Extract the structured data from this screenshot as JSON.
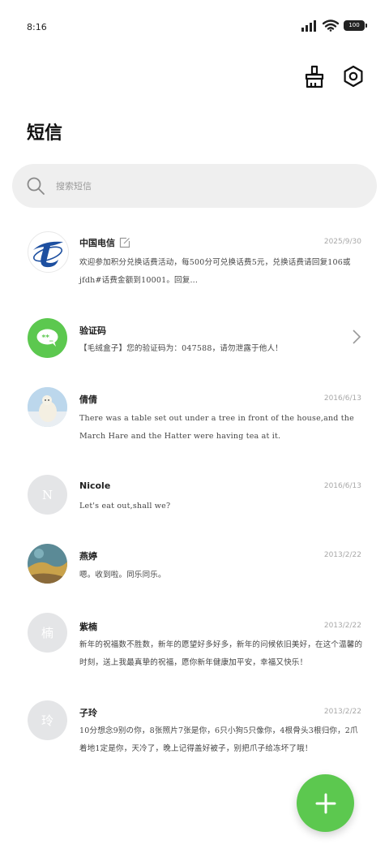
{
  "status_bar": {
    "time": "8:16",
    "battery": "100"
  },
  "header": {
    "title": "短信"
  },
  "search": {
    "placeholder": "搜索短信"
  },
  "conversations": [
    {
      "name": "中国电信",
      "date": "2025/9/30",
      "preview": "欢迎参加积分兑换话费活动，每500分可兑换话费5元，兑换话费请回复106或jfdh#话费金额到10001。回复...",
      "avatar": "china-telecom-logo",
      "has_edit_icon": true
    },
    {
      "name": "验证码",
      "date": "",
      "preview": "【毛绒盒子】您的验证码为：047588，请勿泄露于他人！",
      "avatar": "sms-bubble-icon",
      "avatar_color": "#5cc84f",
      "has_chevron": true
    },
    {
      "name": "倩倩",
      "date": "2016/6/13",
      "preview": "There was a table set out under a tree in front of the house,and the March Hare and the Hatter were having tea at it.",
      "avatar": "polar-bear-photo"
    },
    {
      "name": "Nicole",
      "date": "2016/6/13",
      "preview": "Let's eat out,shall we?",
      "avatar_letter": "N"
    },
    {
      "name": "燕婷",
      "date": "2013/2/22",
      "preview": "嗯。收到啦。同乐同乐。",
      "avatar": "landscape-photo"
    },
    {
      "name": "紫楠",
      "date": "2013/2/22",
      "preview": "新年的祝福数不胜数，新年的愿望好多好多，新年的问候依旧美好，在这个温馨的时刻，送上我最真挚的祝福，愿你新年健康加平安，幸福又快乐！",
      "avatar_letter": "楠"
    },
    {
      "name": "子玲",
      "date": "2013/2/22",
      "preview": "10分想念9别の你，8张照片7张是你，6只小狗5只像你，4根骨头3根归你，2爪着地1定是你，天冷了，晚上记得盖好被子，别把爪子给冻坏了哦！",
      "avatar_letter": "玲"
    }
  ],
  "colors": {
    "accent": "#5cc84f",
    "search_bg": "#efefef",
    "telecom_blue": "#1d4fa0"
  },
  "icons": {
    "clean": "broom-icon",
    "settings": "settings-hex-icon",
    "compose": "plus-icon"
  }
}
